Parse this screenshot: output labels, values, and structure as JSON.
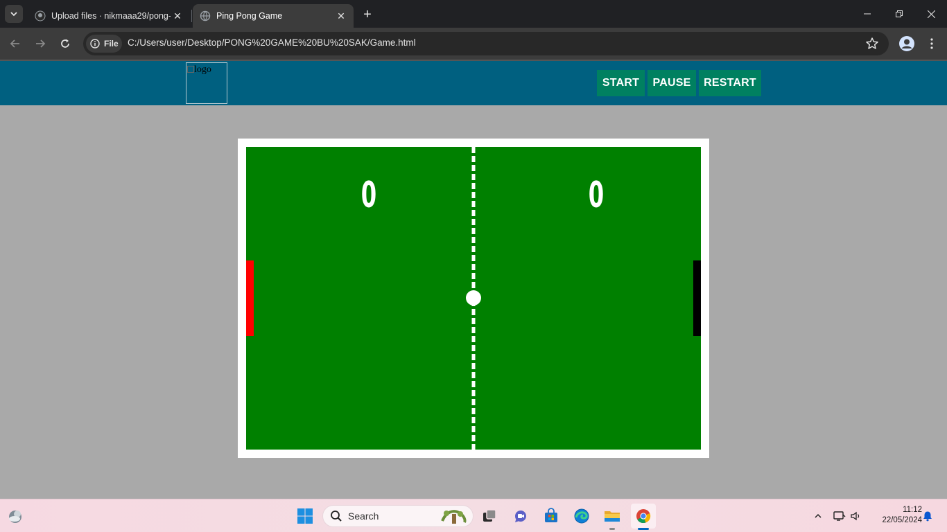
{
  "browser": {
    "tabs": [
      {
        "title": "Upload files · nikmaaa29/pong-",
        "active": false,
        "favicon": "github-icon"
      },
      {
        "title": "Ping Pong Game",
        "active": true,
        "favicon": "globe-icon"
      }
    ],
    "address_chip": "File",
    "url": "C:/Users/user/Desktop/PONG%20GAME%20BU%20SAK/Game.html"
  },
  "header": {
    "logo_alt": "logo",
    "buttons": {
      "start": "START",
      "pause": "PAUSE",
      "restart": "RESTART"
    },
    "colors": {
      "header_bg": "#006080",
      "button_bg": "#008060"
    }
  },
  "game": {
    "score_left": "0",
    "score_right": "0",
    "colors": {
      "court": "#008000",
      "left_paddle": "#ff0000",
      "right_paddle": "#000000",
      "ball": "#ffffff",
      "net": "#ffffff"
    }
  },
  "taskbar": {
    "search_placeholder": "Search",
    "time": "11:12",
    "date": "22/05/2024",
    "pinned": [
      "start-icon",
      "task-view-icon",
      "teams-chat-icon",
      "store-icon",
      "edge-icon",
      "file-explorer-icon",
      "chrome-icon"
    ]
  }
}
